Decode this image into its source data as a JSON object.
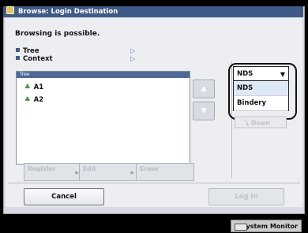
{
  "window": {
    "title": "Browse: Login Destination"
  },
  "message": "Browsing is possible.",
  "info": {
    "tree_label": "Tree",
    "context_label": "Context"
  },
  "tree_panel": {
    "header": "Tree",
    "items": [
      {
        "label": "A1",
        "icon": "tree-icon"
      },
      {
        "label": "A2",
        "icon": "tree-icon"
      }
    ]
  },
  "actions": {
    "register": "Register",
    "edit": "Edit",
    "erase": "Erase"
  },
  "footer": {
    "cancel": "Cancel",
    "login": "Log In"
  },
  "dropdown": {
    "selected": "NDS",
    "options": [
      "NDS",
      "Bindery"
    ],
    "highlighted_option": "NDS"
  },
  "down_button": "Down",
  "status": {
    "system_monitor": "System Monitor"
  },
  "colors": {
    "title_bar": "#3f5a86",
    "panel_header": "#4f6894",
    "tree_icon": "#3a8a3a"
  }
}
